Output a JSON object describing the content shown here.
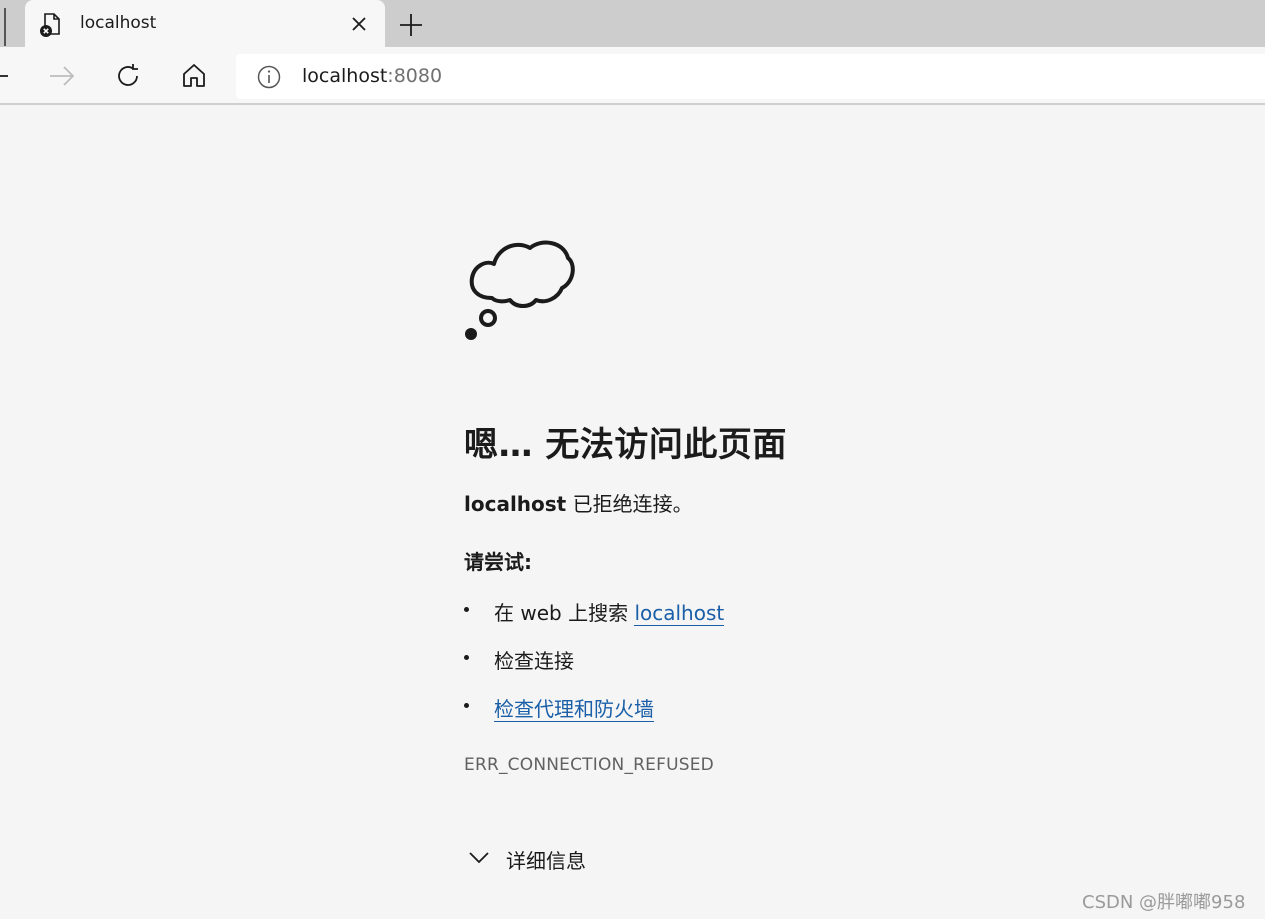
{
  "tab": {
    "title": "localhost"
  },
  "omnibox": {
    "host": "localhost",
    "port": ":8080"
  },
  "error": {
    "heading": "嗯… 无法访问此页面",
    "refused_host": "localhost",
    "refused_text": " 已拒绝连接。",
    "try_label": "请尝试:",
    "suggestions": [
      {
        "prefix": "在 web 上搜索 ",
        "link": "localhost"
      },
      {
        "text": "检查连接"
      },
      {
        "link": "检查代理和防火墙"
      }
    ],
    "code": "ERR_CONNECTION_REFUSED",
    "details_label": "详细信息"
  },
  "watermark": "CSDN @胖嘟嘟958",
  "colors": {
    "link": "#1a5fa8",
    "background": "#f5f5f5",
    "tabstrip": "#cdcdcd"
  }
}
